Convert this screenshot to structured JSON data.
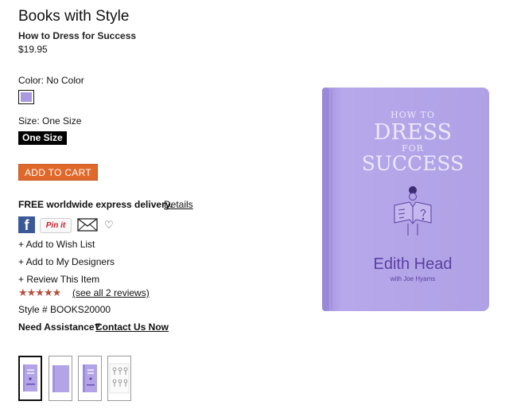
{
  "product": {
    "brand": "Books with Style",
    "title": "How to Dress for Success",
    "price": "$19.95"
  },
  "options": {
    "color_label": "Color: No Color",
    "size_label": "Size: One Size",
    "size_value": "One Size",
    "swatch_color": "#a99ae0"
  },
  "actions": {
    "add_to_cart": "ADD TO CART",
    "delivery_text": "FREE worldwide express delivery.",
    "details_link": "Details",
    "facebook_letter": "f",
    "pinit_label": "Pin it",
    "add_wish_list": "+ Add to Wish List",
    "add_designers": "+ Add to My Designers",
    "review_item": "+ Review This Item"
  },
  "reviews": {
    "rating": 5,
    "stars": "★★★★★",
    "see_all": "(see all 2 reviews)"
  },
  "meta": {
    "style_number": "Style # BOOKS20000",
    "need_assistance": "Need Assistance?",
    "contact_link": "Contact Us Now"
  },
  "book_cover": {
    "title_line1": "HOW TO",
    "title_line2": "DRESS",
    "title_line3": "FOR",
    "title_line4": "SUCCESS",
    "author": "Edith Head",
    "coauthor": "with Joe Hyams",
    "cover_color": "#b3a4e8"
  },
  "thumbnails": [
    {
      "name": "front cover",
      "selected": true
    },
    {
      "name": "cover side",
      "selected": false
    },
    {
      "name": "spine view",
      "selected": false
    },
    {
      "name": "interior page",
      "selected": false
    }
  ]
}
